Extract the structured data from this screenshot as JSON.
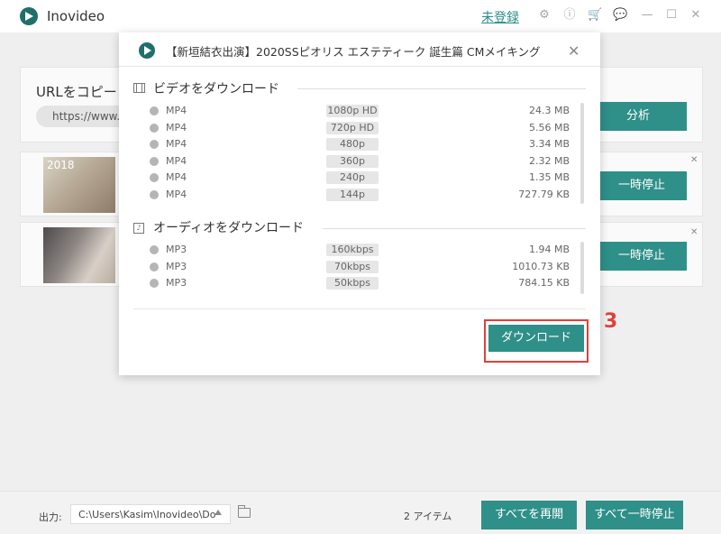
{
  "app": {
    "title": "Inovideo",
    "login_link": "未登録"
  },
  "main": {
    "url_label": "URLをコピーし",
    "url_value": "https://www.y",
    "analyze_label": "分析",
    "downloads": [
      {
        "thumb_text": "2018",
        "pause_label": "一時停止"
      },
      {
        "thumb_text": "",
        "pause_label": "一時停止"
      }
    ]
  },
  "footer": {
    "output_label": "出力:",
    "output_path": "C:\\Users\\Kasim\\Inovideo\\Do",
    "item_count": "2 アイテム",
    "resume_all_label": "すべてを再開",
    "pause_all_label": "すべて一時停止"
  },
  "dialog": {
    "title": "【新垣結衣出演】2020SSピオリス エステティーク 誕生篇 CMメイキング",
    "video_section": "ビデオをダウンロード",
    "audio_section": "オーディオをダウンロード",
    "video_options": [
      {
        "format": "MP4",
        "quality": "1080p HD",
        "size": "24.3 MB"
      },
      {
        "format": "MP4",
        "quality": "720p HD",
        "size": "5.56 MB"
      },
      {
        "format": "MP4",
        "quality": "480p",
        "size": "3.34 MB"
      },
      {
        "format": "MP4",
        "quality": "360p",
        "size": "2.32 MB"
      },
      {
        "format": "MP4",
        "quality": "240p",
        "size": "1.35 MB"
      },
      {
        "format": "MP4",
        "quality": "144p",
        "size": "727.79 KB"
      }
    ],
    "audio_options": [
      {
        "format": "MP3",
        "quality": "160kbps",
        "size": "1.94 MB"
      },
      {
        "format": "MP3",
        "quality": "70kbps",
        "size": "1010.73 KB"
      },
      {
        "format": "MP3",
        "quality": "50kbps",
        "size": "784.15 KB"
      }
    ],
    "download_label": "ダウンロード",
    "step_number": "3"
  },
  "colors": {
    "accent": "#2f8f89",
    "highlight": "#e0403a"
  }
}
